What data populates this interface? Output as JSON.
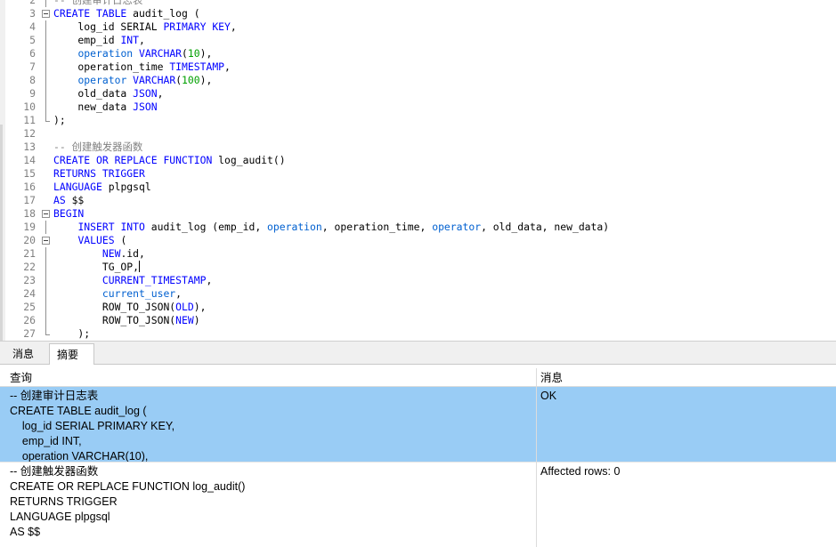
{
  "editor": {
    "lines": [
      {
        "n": "2",
        "fold": "vline",
        "tokens": [
          [
            "cm",
            "-- 创建审计日志表"
          ]
        ]
      },
      {
        "n": "3",
        "fold": "box",
        "tokens": [
          [
            "kw",
            "CREATE TABLE"
          ],
          [
            "pl",
            " audit_log ("
          ]
        ]
      },
      {
        "n": "4",
        "fold": "vline",
        "tokens": [
          [
            "pl",
            "    log_id SERIAL "
          ],
          [
            "kw",
            "PRIMARY KEY"
          ],
          [
            "pl",
            ","
          ]
        ]
      },
      {
        "n": "5",
        "fold": "vline",
        "tokens": [
          [
            "pl",
            "    emp_id "
          ],
          [
            "kw",
            "INT"
          ],
          [
            "pl",
            ","
          ]
        ]
      },
      {
        "n": "6",
        "fold": "vline",
        "tokens": [
          [
            "pl",
            "    "
          ],
          [
            "fn",
            "operation"
          ],
          [
            "pl",
            " "
          ],
          [
            "kw",
            "VARCHAR"
          ],
          [
            "pl",
            "("
          ],
          [
            "nm",
            "10"
          ],
          [
            "pl",
            "),"
          ]
        ]
      },
      {
        "n": "7",
        "fold": "vline",
        "tokens": [
          [
            "pl",
            "    operation_time "
          ],
          [
            "kw",
            "TIMESTAMP"
          ],
          [
            "pl",
            ","
          ]
        ]
      },
      {
        "n": "8",
        "fold": "vline",
        "tokens": [
          [
            "pl",
            "    "
          ],
          [
            "fn",
            "operator"
          ],
          [
            "pl",
            " "
          ],
          [
            "kw",
            "VARCHAR"
          ],
          [
            "pl",
            "("
          ],
          [
            "nm",
            "100"
          ],
          [
            "pl",
            "),"
          ]
        ]
      },
      {
        "n": "9",
        "fold": "vline",
        "tokens": [
          [
            "pl",
            "    old_data "
          ],
          [
            "kw",
            "JSON"
          ],
          [
            "pl",
            ","
          ]
        ]
      },
      {
        "n": "10",
        "fold": "vline",
        "tokens": [
          [
            "pl",
            "    new_data "
          ],
          [
            "kw",
            "JSON"
          ]
        ]
      },
      {
        "n": "11",
        "fold": "end",
        "tokens": [
          [
            "pl",
            ");"
          ]
        ]
      },
      {
        "n": "12",
        "fold": "",
        "tokens": []
      },
      {
        "n": "13",
        "fold": "",
        "tokens": [
          [
            "cm",
            "-- 创建触发器函数"
          ]
        ]
      },
      {
        "n": "14",
        "fold": "",
        "tokens": [
          [
            "kw",
            "CREATE OR REPLACE FUNCTION"
          ],
          [
            "pl",
            " log_audit()"
          ]
        ]
      },
      {
        "n": "15",
        "fold": "",
        "tokens": [
          [
            "kw",
            "RETURNS TRIGGER"
          ]
        ]
      },
      {
        "n": "16",
        "fold": "",
        "tokens": [
          [
            "kw",
            "LANGUAGE"
          ],
          [
            "pl",
            " plpgsql"
          ]
        ]
      },
      {
        "n": "17",
        "fold": "",
        "tokens": [
          [
            "kw",
            "AS"
          ],
          [
            "pl",
            " $$"
          ]
        ]
      },
      {
        "n": "18",
        "fold": "box",
        "tokens": [
          [
            "kw",
            "BEGIN"
          ]
        ]
      },
      {
        "n": "19",
        "fold": "vline",
        "tokens": [
          [
            "pl",
            "    "
          ],
          [
            "kw",
            "INSERT INTO"
          ],
          [
            "pl",
            " audit_log (emp_id, "
          ],
          [
            "fn",
            "operation"
          ],
          [
            "pl",
            ", operation_time, "
          ],
          [
            "fn",
            "operator"
          ],
          [
            "pl",
            ", old_data, new_data)"
          ]
        ]
      },
      {
        "n": "20",
        "fold": "box",
        "tokens": [
          [
            "pl",
            "    "
          ],
          [
            "kw",
            "VALUES"
          ],
          [
            "pl",
            " ("
          ]
        ]
      },
      {
        "n": "21",
        "fold": "vline",
        "tokens": [
          [
            "pl",
            "        "
          ],
          [
            "kw",
            "NEW"
          ],
          [
            "pl",
            ".id,"
          ]
        ]
      },
      {
        "n": "22",
        "fold": "vline",
        "tokens": [
          [
            "pl",
            "        TG_OP,"
          ],
          [
            "caret",
            ""
          ]
        ]
      },
      {
        "n": "23",
        "fold": "vline",
        "tokens": [
          [
            "pl",
            "        "
          ],
          [
            "kw",
            "CURRENT_TIMESTAMP"
          ],
          [
            "pl",
            ","
          ]
        ]
      },
      {
        "n": "24",
        "fold": "vline",
        "tokens": [
          [
            "pl",
            "        "
          ],
          [
            "fn",
            "current_user"
          ],
          [
            "pl",
            ","
          ]
        ]
      },
      {
        "n": "25",
        "fold": "vline",
        "tokens": [
          [
            "pl",
            "        ROW_TO_JSON("
          ],
          [
            "kw",
            "OLD"
          ],
          [
            "pl",
            "),"
          ]
        ]
      },
      {
        "n": "26",
        "fold": "vline",
        "tokens": [
          [
            "pl",
            "        ROW_TO_JSON("
          ],
          [
            "kw",
            "NEW"
          ],
          [
            "pl",
            ")"
          ]
        ]
      },
      {
        "n": "27",
        "fold": "end",
        "tokens": [
          [
            "pl",
            "    );"
          ]
        ]
      }
    ]
  },
  "tabs": {
    "messages": "消息",
    "summary": "摘要"
  },
  "grid": {
    "headers": {
      "query": "查询",
      "message": "消息"
    },
    "rows": [
      {
        "query": "-- 创建审计日志表\nCREATE TABLE audit_log (\n    log_id SERIAL PRIMARY KEY,\n    emp_id INT,\n    operation VARCHAR(10),",
        "message": "OK"
      },
      {
        "query": "-- 创建触发器函数\nCREATE OR REPLACE FUNCTION log_audit()\nRETURNS TRIGGER\nLANGUAGE plpgsql\nAS $$",
        "message": "Affected rows: 0"
      }
    ]
  },
  "colors": {
    "keyword": "#0000ff",
    "identifier": "#0060d0",
    "comment": "#808080",
    "number": "#00a000",
    "selected_row": "#99ccf5"
  }
}
